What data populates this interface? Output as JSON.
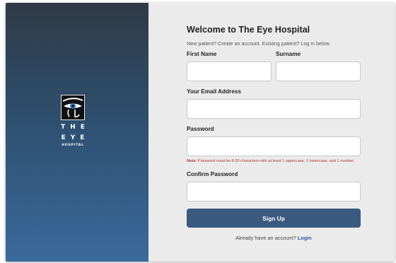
{
  "brand": {
    "logo_word_1": "THE",
    "logo_word_2": "EYE",
    "logo_sub": "HOSPITAL",
    "icon": "eye-of-horus-logo"
  },
  "header": {
    "title": "Welcome to The Eye Hospital",
    "subtitle": "New patient? Create an account. Existing patient? Log in below."
  },
  "form": {
    "first_name_label": "First Name",
    "first_name_value": "",
    "surname_label": "Surname",
    "surname_value": "",
    "email_label": "Your Email Address",
    "email_value": "",
    "password_label": "Password",
    "password_value": "",
    "note_prefix": "Note:",
    "note_text": " Password must be 8-20 characters with at least 1 uppercase, 1 lowercase, and 1 number.",
    "confirm_label": "Confirm Password",
    "confirm_value": "",
    "submit_label": "Sign Up"
  },
  "footer": {
    "text": "Already have an account? ",
    "login_label": "Login"
  },
  "colors": {
    "panel_top": "#2f3a46",
    "panel_bottom": "#3a6a9c",
    "button": "#3a5a80",
    "note": "#b03a2e",
    "link": "#2f5aa0"
  }
}
